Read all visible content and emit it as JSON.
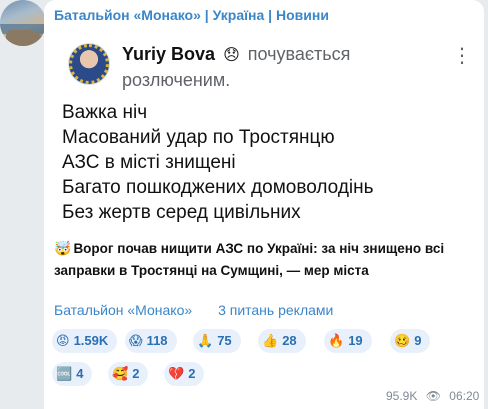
{
  "channel": {
    "name": "Батальйон «Монако» | Україна | Новини"
  },
  "post": {
    "author_name": "Yuriy Bova",
    "status_emoji": "😞",
    "status_text": "почувається",
    "status_text_2": "розлюченим.",
    "more_icon": "⋮",
    "lines": [
      "Важка ніч",
      "Масований удар по Тростянцю",
      "АЗС в місті знищені",
      "Багато пошкоджених домоволодінь",
      "Без жертв серед цивільних"
    ]
  },
  "headline": {
    "emoji": "🤯",
    "text": "Ворог почав нищити АЗС по Україні: за ніч знищено всі заправки в Тростянці на Сумщині, — мер міста"
  },
  "links": {
    "channel": "Батальйон «Монако»",
    "ads": "3 питань реклами"
  },
  "reactions": [
    {
      "emoji": "😡",
      "count": "1.59K"
    },
    {
      "emoji": "😱",
      "count": "118"
    },
    {
      "emoji": "🙏",
      "count": "75"
    },
    {
      "emoji": "👍",
      "count": "28"
    },
    {
      "emoji": "🔥",
      "count": "19"
    },
    {
      "emoji": "🥴",
      "count": "9"
    },
    {
      "emoji": "🆒",
      "count": "4"
    },
    {
      "emoji": "🥰",
      "count": "2"
    },
    {
      "emoji": "💔",
      "count": "2"
    }
  ],
  "meta": {
    "views": "95.9K",
    "eye_icon": "👁",
    "time": "06:20"
  }
}
